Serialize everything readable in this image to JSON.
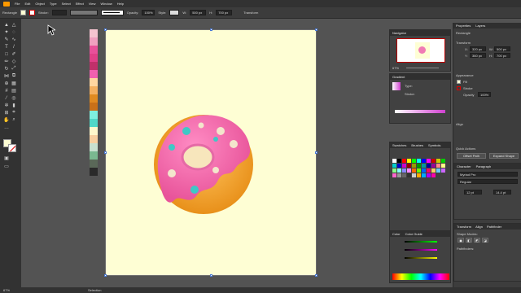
{
  "menubar": {
    "items": [
      "File",
      "Edit",
      "Object",
      "Type",
      "Select",
      "Effect",
      "View",
      "Window",
      "Help"
    ]
  },
  "control_bar": {
    "selection_label": "Rectangle",
    "stroke_label": "Stroke:",
    "opacity_label": "Opacity:",
    "opacity_value": "100%",
    "style_label": "Style:",
    "w_label": "W:",
    "w_value": "500 px",
    "h_label": "H:",
    "h_value": "700 px",
    "transform_label": "Transform"
  },
  "canvas": {
    "swatches": [
      "#f5c4d0",
      "#f0a0c0",
      "#e8509a",
      "#e04088",
      "#c0306a",
      "#f060b0",
      "#ffd6a0",
      "#f4b060",
      "#e08a20",
      "#c87018",
      "#7ef0e0",
      "#50d8c8",
      "#fff8cc",
      "#f8cfa0",
      "#c8e0d0",
      "#7ab890",
      "#5a6858",
      "#2a2a2a"
    ]
  },
  "navigator": {
    "title": "Navigator",
    "zoom": "67%"
  },
  "gradient": {
    "title": "Gradient",
    "type_label": "Type:",
    "stroke_label": "Stroke:"
  },
  "swatches_panel": {
    "tabs": [
      "Swatches",
      "Brushes",
      "Symbols"
    ]
  },
  "color_panel": {
    "tabs": [
      "Color",
      "Color Guide"
    ]
  },
  "properties": {
    "tabs": [
      "Properties",
      "Layers"
    ],
    "section_rect": "Rectangle",
    "transform": "Transform",
    "x_label": "X:",
    "x_value": "320 px",
    "y_label": "Y:",
    "y_value": "360 px",
    "w_label": "W:",
    "w_value": "500 px",
    "h_label": "H:",
    "h_value": "700 px",
    "appearance": "Appearance",
    "fill_label": "Fill",
    "stroke_label": "Stroke",
    "opacity_label": "Opacity",
    "opacity_value": "100%",
    "align": "Align",
    "quick_actions": "Quick Actions",
    "offset_path": "Offset Path",
    "expand_shape": "Expand Shape"
  },
  "character": {
    "tabs": [
      "Character",
      "Paragraph"
    ],
    "font": "Myriad Pro",
    "style": "Regular",
    "size": "12 pt",
    "leading": "14.4 pt"
  },
  "transform_tabs": [
    "Transform",
    "Align",
    "Pathfinder"
  ],
  "pathfinder": {
    "shape_modes": "Shape Modes:",
    "pathfinders": "Pathfinders:"
  },
  "status": {
    "zoom": "67%",
    "mode": "Selection"
  },
  "colors": {
    "pink": "#f06aa8",
    "cream": "#fefed4",
    "dough": "#f2a43a"
  }
}
